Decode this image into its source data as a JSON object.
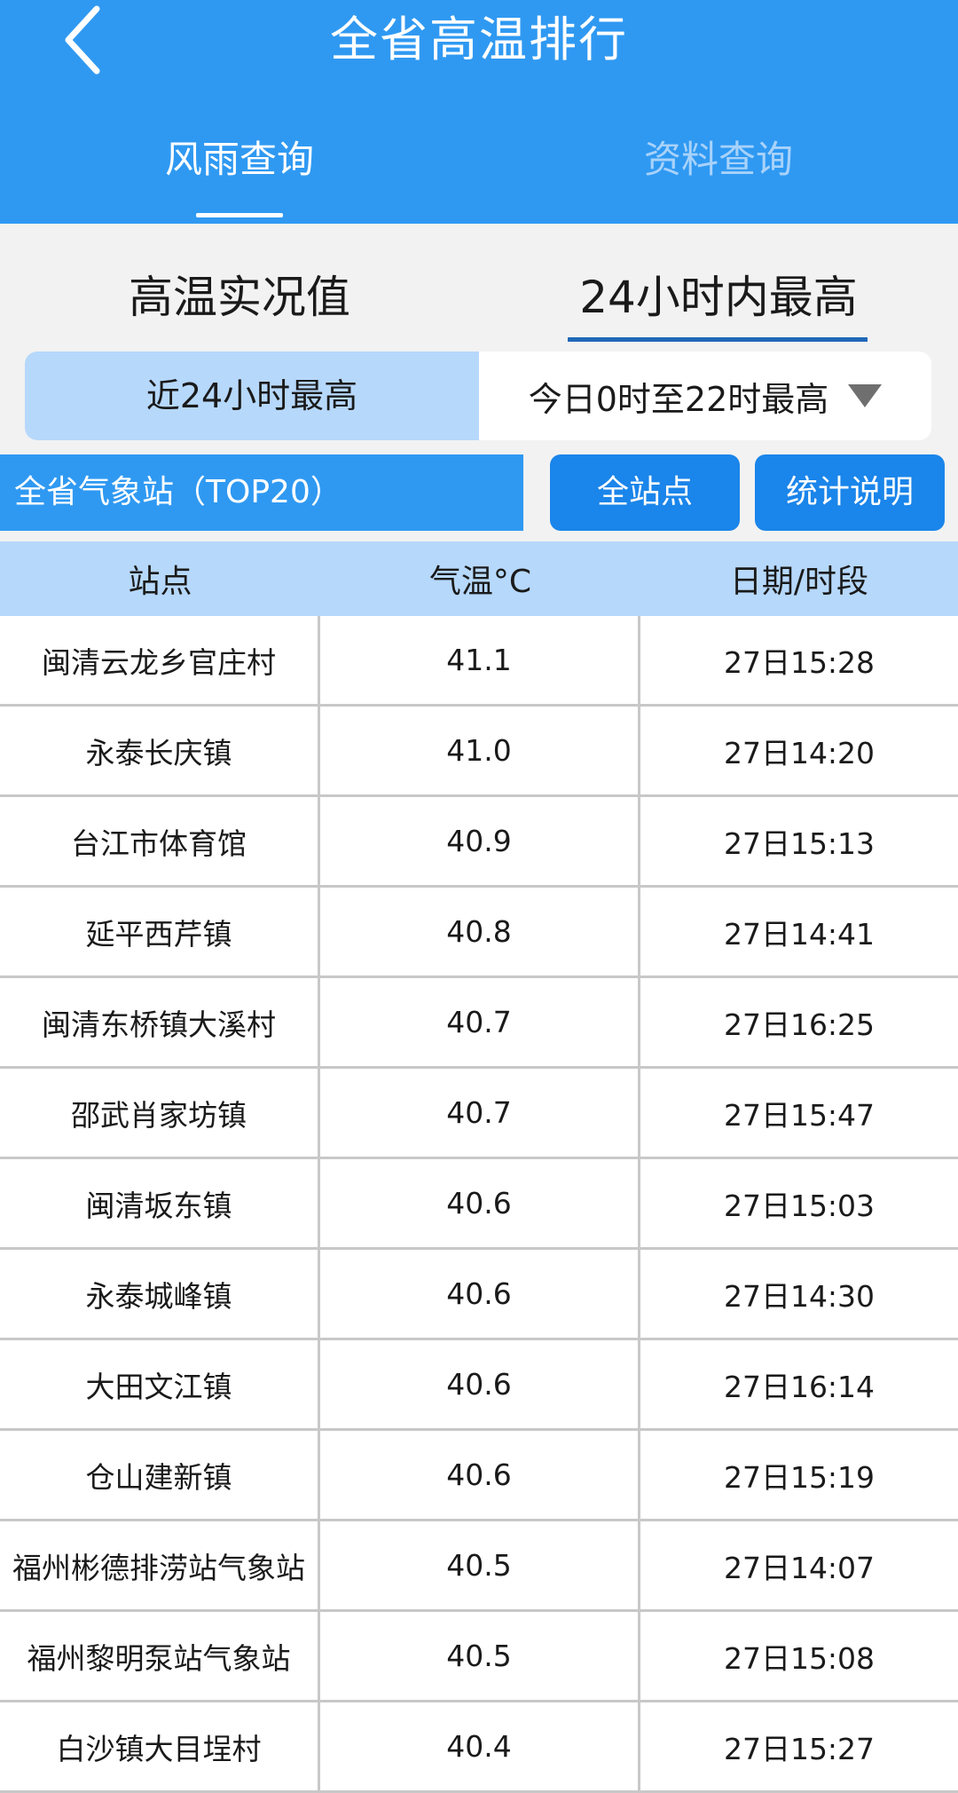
{
  "header": {
    "title": "全省高温排行",
    "tabs": [
      {
        "label": "风雨查询",
        "active": true
      },
      {
        "label": "资料查询",
        "active": false
      }
    ]
  },
  "subtabs": [
    {
      "label": "高温实况值",
      "active": false
    },
    {
      "label": "24小时内最高",
      "active": true
    }
  ],
  "segment": {
    "left_label": "近24小时最高",
    "right_label": "今日0时至22时最高"
  },
  "section": {
    "label": "全省气象站（TOP20）",
    "all_stations_button": "全站点",
    "stats_button": "统计说明"
  },
  "table": {
    "headers": [
      "站点",
      "气温°C",
      "日期/时段"
    ],
    "rows": [
      {
        "station": "闽清云龙乡官庄村",
        "temp": "41.1",
        "time": "27日15:28"
      },
      {
        "station": "永泰长庆镇",
        "temp": "41.0",
        "time": "27日14:20"
      },
      {
        "station": "台江市体育馆",
        "temp": "40.9",
        "time": "27日15:13"
      },
      {
        "station": "延平西芹镇",
        "temp": "40.8",
        "time": "27日14:41"
      },
      {
        "station": "闽清东桥镇大溪村",
        "temp": "40.7",
        "time": "27日16:25"
      },
      {
        "station": "邵武肖家坊镇",
        "temp": "40.7",
        "time": "27日15:47"
      },
      {
        "station": "闽清坂东镇",
        "temp": "40.6",
        "time": "27日15:03"
      },
      {
        "station": "永泰城峰镇",
        "temp": "40.6",
        "time": "27日14:30"
      },
      {
        "station": "大田文江镇",
        "temp": "40.6",
        "time": "27日16:14"
      },
      {
        "station": "仓山建新镇",
        "temp": "40.6",
        "time": "27日15:19"
      },
      {
        "station": "福州彬德排涝站气象站",
        "temp": "40.5",
        "time": "27日14:07"
      },
      {
        "station": "福州黎明泵站气象站",
        "temp": "40.5",
        "time": "27日15:08"
      },
      {
        "station": "白沙镇大目埕村",
        "temp": "40.4",
        "time": "27日15:27"
      }
    ]
  },
  "colors": {
    "header_blue": "#2f99f2",
    "button_blue": "#1a85ea",
    "light_blue": "#b6d8fb",
    "underline_blue": "#1f68b8"
  }
}
